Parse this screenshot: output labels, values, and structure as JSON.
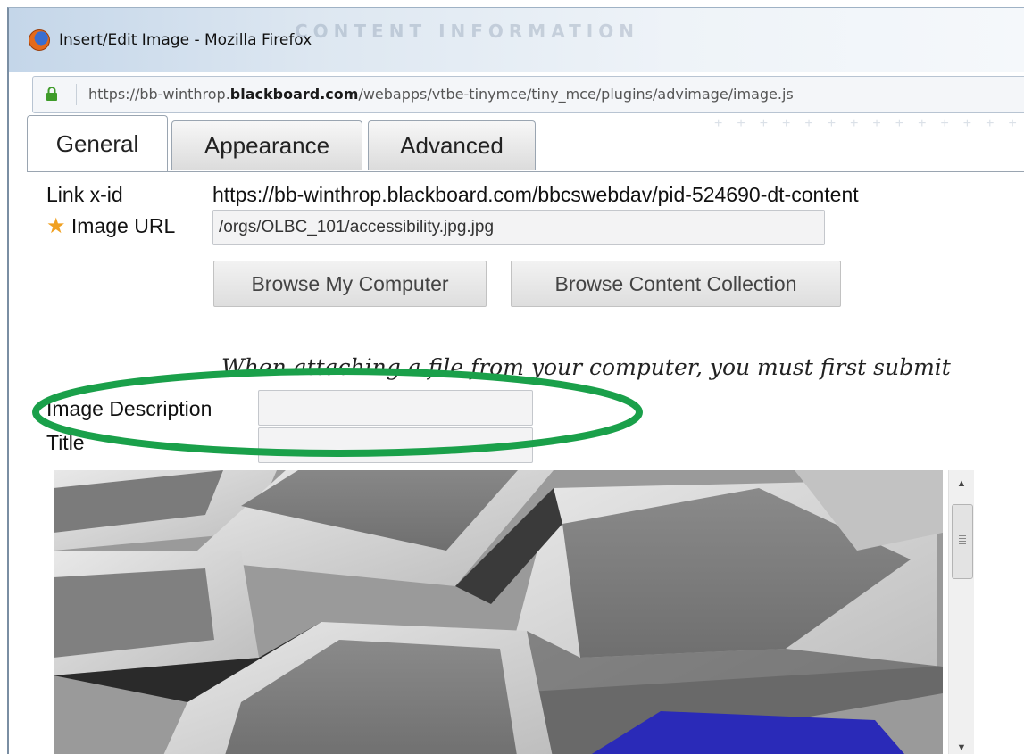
{
  "window": {
    "title": "Insert/Edit Image - Mozilla Firefox",
    "background_caption": "CONTENT INFORMATION"
  },
  "address_bar": {
    "url_prefix": "https://bb-winthrop.",
    "url_domain": "blackboard.com",
    "url_path": "/webapps/vtbe-tinymce/tiny_mce/plugins/advimage/image.js"
  },
  "tabs": [
    {
      "label": "General",
      "active": true
    },
    {
      "label": "Appearance",
      "active": false
    },
    {
      "label": "Advanced",
      "active": false
    }
  ],
  "form": {
    "link_xid_label": "Link x-id",
    "link_xid_value": "https://bb-winthrop.blackboard.com/bbcswebdav/pid-524690-dt-content",
    "image_url_label": "Image URL",
    "image_url_value": "/orgs/OLBC_101/accessibility.jpg.jpg",
    "browse_computer_label": "Browse My Computer",
    "browse_collection_label": "Browse Content Collection",
    "note": "When attaching a file from your computer, you must first submit",
    "image_description_label": "Image Description",
    "image_description_value": "",
    "title_label": "Title",
    "title_value": ""
  },
  "colors": {
    "highlight": "#1aa04a",
    "required_star": "#f0a020",
    "key_blue": "#2a2ab8"
  },
  "icons": {
    "browser": "firefox-icon",
    "security": "lock-icon",
    "required": "star-icon"
  }
}
